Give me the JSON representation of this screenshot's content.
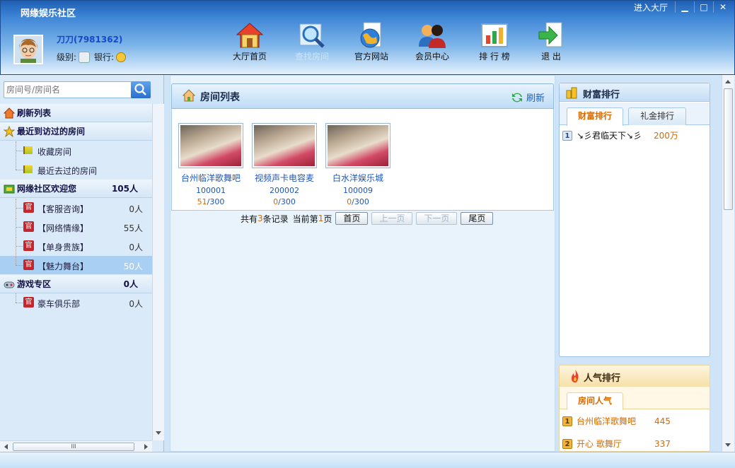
{
  "window": {
    "title": "网缘娱乐社区",
    "enter_hall": "进入大厅",
    "min": "▁",
    "max": "□",
    "close": "✕"
  },
  "user": {
    "name": "刀刀(7981362)",
    "level_label": "级别:",
    "bank_label": "银行:"
  },
  "nav": [
    {
      "label": "大厅首页",
      "icon": "house-icon"
    },
    {
      "label": "查找房间",
      "icon": "magnifier-icon"
    },
    {
      "label": "官方网站",
      "icon": "globe-icon"
    },
    {
      "label": "会员中心",
      "icon": "users-icon"
    },
    {
      "label": "排 行 榜",
      "icon": "chart-icon"
    },
    {
      "label": "退  出",
      "icon": "exit-arrow-icon"
    }
  ],
  "sidebar": {
    "search_placeholder": "房间号/房间名",
    "groups": [
      {
        "label": "刷新列表"
      },
      {
        "label": "最近到访过的房间",
        "children": [
          {
            "label": "收藏房间"
          },
          {
            "label": "最近去过的房间"
          }
        ]
      },
      {
        "label": "网缘社区欢迎您",
        "count": "105人",
        "children": [
          {
            "label": "【客服咨询】",
            "count": "0人"
          },
          {
            "label": "【网络情缘】",
            "count": "55人"
          },
          {
            "label": "【单身贵族】",
            "count": "0人"
          },
          {
            "label": "【魅力舞台】",
            "count": "50人"
          }
        ]
      },
      {
        "label": "游戏专区",
        "count": "0人",
        "children": [
          {
            "label": "豪车俱乐部",
            "count": "0人"
          }
        ]
      }
    ],
    "guan_badge": "官",
    "hscroll_grip": "III"
  },
  "room_list": {
    "title": "房间列表",
    "refresh": "刷新",
    "rooms": [
      {
        "name": "台州临洋歌舞吧",
        "id": "100001",
        "current": "51",
        "capacity": "/300"
      },
      {
        "name": "视频声卡电容麦",
        "id": "200002",
        "current": "0",
        "capacity": "/300"
      },
      {
        "name": "白水洋娱乐城",
        "id": "100009",
        "current": "0",
        "capacity": "/300"
      }
    ],
    "pager": {
      "total_prefix": "共有",
      "total": "3",
      "total_suffix": "条记录",
      "page_prefix": "当前第",
      "page": "1",
      "page_suffix": "页",
      "first": "首页",
      "prev": "上一页",
      "next": "下一页",
      "last": "尾页"
    }
  },
  "wealth": {
    "title": "财富排行",
    "tab_active": "财富排行",
    "tab_other": "礼金排行",
    "rows": [
      {
        "rank": "1",
        "name": "↘彡君临天下↘彡",
        "value": "200万"
      }
    ]
  },
  "popular": {
    "title": "人气排行",
    "tab": "房间人气",
    "rows": [
      {
        "rank": "1",
        "name": "台州临洋歌舞吧",
        "value": "445"
      },
      {
        "rank": "2",
        "name": "开心 歌舞厅",
        "value": "337"
      }
    ]
  },
  "colors": {
    "header_top": "#1f5fb5",
    "accent_blue": "#1d56b9",
    "accent_orange": "#d56a00",
    "badge_red": "#c1272d"
  }
}
